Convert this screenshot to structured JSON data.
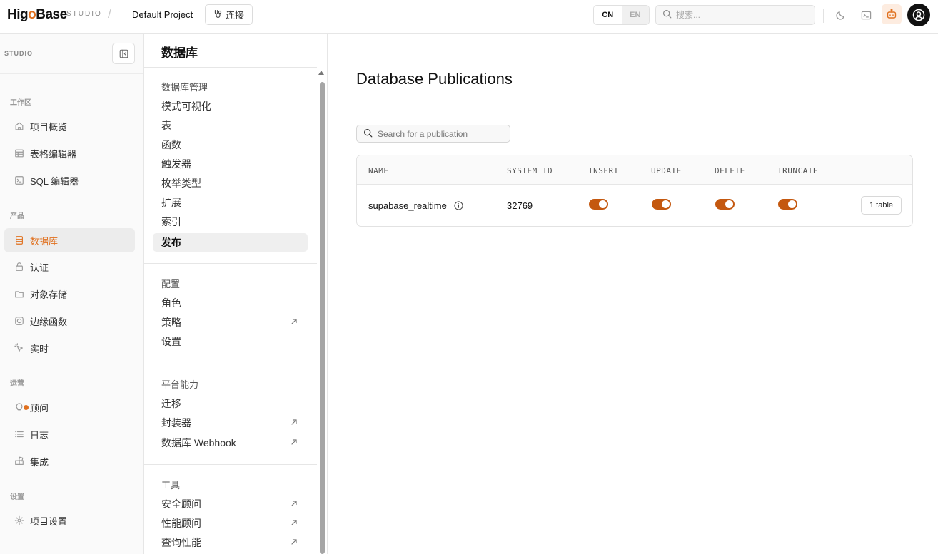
{
  "topbar": {
    "brand": {
      "pre": "Hi",
      "mid": "g",
      "o": "o",
      "post": "Base"
    },
    "studio_tag": "STUDIO",
    "separator": "/",
    "project": "Default Project",
    "connect_label": "连接",
    "lang": {
      "cn": "CN",
      "en": "EN",
      "active": "CN"
    },
    "search_placeholder": "搜索..."
  },
  "sidebar": {
    "studio_label": "STUDIO",
    "sections": {
      "workspace": "工作区",
      "product": "产品",
      "operations": "运营",
      "settings": "设置"
    },
    "items": {
      "overview": "项目概览",
      "table_editor": "表格编辑器",
      "sql_editor": "SQL 编辑器",
      "database": "数据库",
      "auth": "认证",
      "storage": "对象存储",
      "edge_functions": "边缘函数",
      "realtime": "实时",
      "advisor": "顾问",
      "logs": "日志",
      "integrations": "集成",
      "project_settings": "项目设置"
    },
    "active": "database"
  },
  "subnav": {
    "title": "数据库",
    "groups": {
      "management": "数据库管理",
      "config": "配置",
      "platform": "平台能力",
      "tools": "工具"
    },
    "items": {
      "schema_viz": "模式可视化",
      "tables": "表",
      "functions": "函数",
      "triggers": "触发器",
      "enums": "枚举类型",
      "extensions": "扩展",
      "indexes": "索引",
      "publications": "发布",
      "roles": "角色",
      "policies": "策略",
      "settings": "设置",
      "migrations": "迁移",
      "wrappers": "封装器",
      "webhooks": "数据库 Webhook",
      "security_advisor": "安全顾问",
      "performance_advisor": "性能顾问",
      "query_performance": "查询性能"
    },
    "active": "publications"
  },
  "main": {
    "title": "Database Publications",
    "search_placeholder": "Search for a publication",
    "table": {
      "headers": {
        "name": "NAME",
        "system_id": "SYSTEM ID",
        "insert": "INSERT",
        "update": "UPDATE",
        "delete": "DELETE",
        "truncate": "TRUNCATE"
      },
      "rows": [
        {
          "name": "supabase_realtime",
          "system_id": "32769",
          "insert": true,
          "update": true,
          "delete": true,
          "truncate": true,
          "tables_label": "1 table"
        }
      ]
    }
  },
  "colors": {
    "accent": "#e0701e",
    "toggle_on": "#c4580f"
  }
}
